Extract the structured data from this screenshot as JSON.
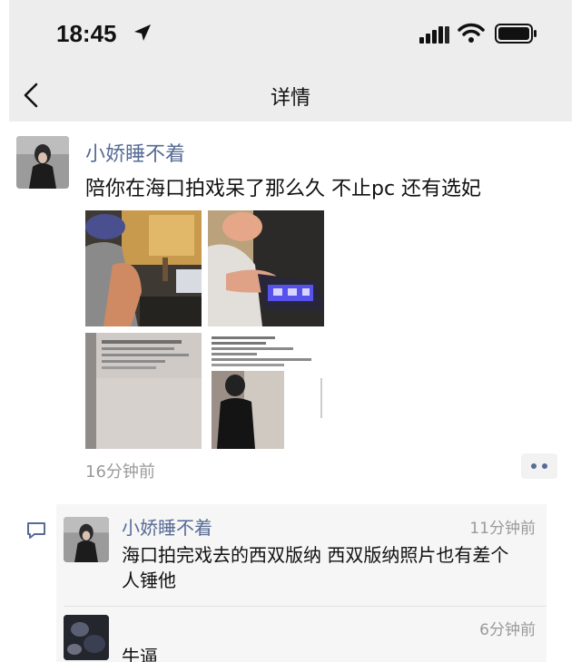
{
  "status_bar": {
    "time": "18:45",
    "icons": [
      "location-arrow-icon",
      "cellular-signal-icon",
      "wifi-icon",
      "battery-icon"
    ]
  },
  "nav": {
    "title": "详情",
    "back_icon": "chevron-left-icon"
  },
  "post": {
    "author": "小娇睡不着",
    "text": "陪你在海口拍戏呆了那么久 不止pc 还有选妃",
    "photo_count": 4,
    "time": "16分钟前",
    "more_icon": "more-dots-icon"
  },
  "comments": [
    {
      "author": "小娇睡不着",
      "time": "11分钟前",
      "text": "海口拍完戏去的西双版纳 西双版纳照片也有差个人锤他"
    },
    {
      "author": "",
      "time": "6分钟前",
      "text": "牛逼"
    }
  ],
  "colors": {
    "link_blue": "#576b95",
    "bar_gray": "#ededed",
    "comment_bg": "#f6f6f6",
    "meta_gray": "#9a9a9a"
  }
}
